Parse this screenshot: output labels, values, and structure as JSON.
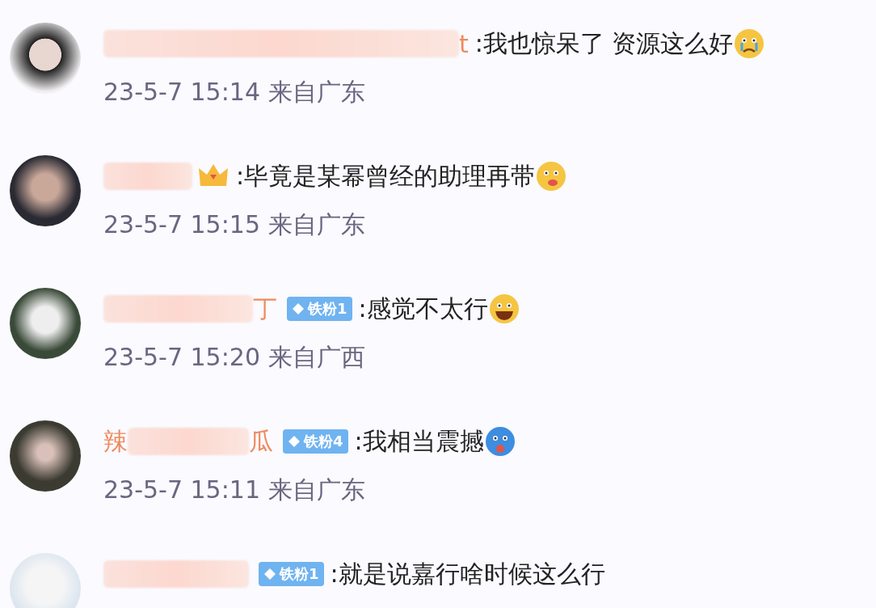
{
  "comments": [
    {
      "avatar": {
        "kind": "hat"
      },
      "name": [
        {
          "kind": "redacted"
        },
        {
          "kind": "text",
          "text": "t"
        }
      ],
      "badge": {
        "kind": "none"
      },
      "text": ":我也惊呆了 资源这么好",
      "emoji": {
        "kind": "crying"
      },
      "time": "23-5-7 15:14 来自广东"
    },
    {
      "avatar": {
        "kind": "dark"
      },
      "name": [
        {
          "kind": "redacted"
        }
      ],
      "badge": {
        "kind": "crown"
      },
      "text": ":毕竟是某幂曾经的助理再带",
      "emoji": {
        "kind": "yum"
      },
      "time": "23-5-7 15:15 来自广东"
    },
    {
      "avatar": {
        "kind": "green"
      },
      "name": [
        {
          "kind": "redacted"
        },
        {
          "kind": "text",
          "text": "丁"
        }
      ],
      "badge": {
        "kind": "fan",
        "label": "铁粉1"
      },
      "text": ":感觉不太行",
      "emoji": {
        "kind": "laugh"
      },
      "time": "23-5-7 15:20 来自广西"
    },
    {
      "avatar": {
        "kind": "tree"
      },
      "name": [
        {
          "kind": "text",
          "text": "辣"
        },
        {
          "kind": "redacted"
        },
        {
          "kind": "text",
          "text": "瓜"
        }
      ],
      "badge": {
        "kind": "fan",
        "label": "铁粉4"
      },
      "text": ":我相当震撼",
      "emoji": {
        "kind": "shocked"
      },
      "time": "23-5-7 15:11 来自广东"
    },
    {
      "avatar": {
        "kind": "cat"
      },
      "name": [
        {
          "kind": "redacted"
        }
      ],
      "badge": {
        "kind": "fan",
        "label": "铁粉1"
      },
      "text": ":就是说嘉行啥时候这么行"
    }
  ]
}
